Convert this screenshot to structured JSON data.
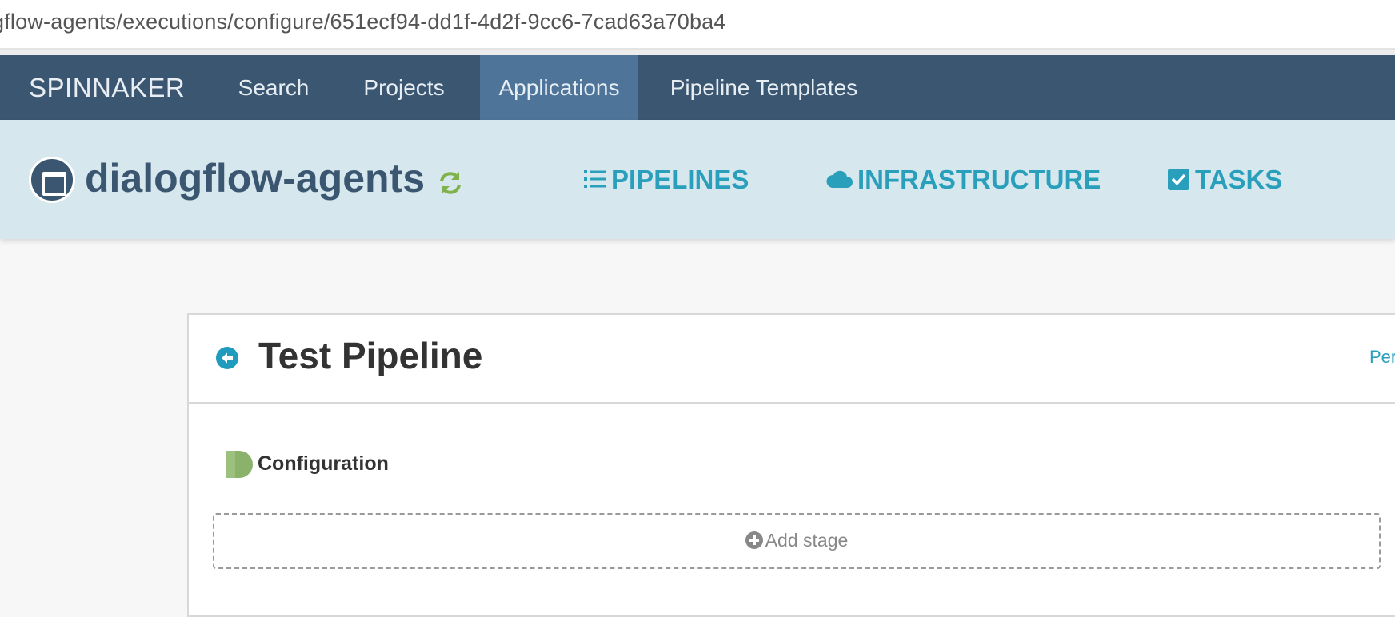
{
  "browser": {
    "url": "gflow-agents/executions/configure/651ecf94-dd1f-4d2f-9cc6-7cad63a70ba4"
  },
  "topnav": {
    "brand": "SPINNAKER",
    "items": [
      {
        "label": "Search",
        "active": false
      },
      {
        "label": "Projects",
        "active": false
      },
      {
        "label": "Applications",
        "active": true
      },
      {
        "label": "Pipeline Templates",
        "active": false
      }
    ]
  },
  "app": {
    "name": "dialogflow-agents",
    "tabs": [
      {
        "label": "PIPELINES",
        "icon": "list-icon"
      },
      {
        "label": "INFRASTRUCTURE",
        "icon": "cloud-icon"
      },
      {
        "label": "TASKS",
        "icon": "checkbox-icon"
      }
    ]
  },
  "pipeline": {
    "title": "Test Pipeline",
    "right_link": "Per",
    "configuration_label": "Configuration",
    "add_stage_label": "Add stage"
  },
  "colors": {
    "nav_bg": "#3b5670",
    "nav_active": "#4e7599",
    "header_bg": "#d6e8ee",
    "accent": "#2a9fbc",
    "config_green": "#8bb26b"
  }
}
